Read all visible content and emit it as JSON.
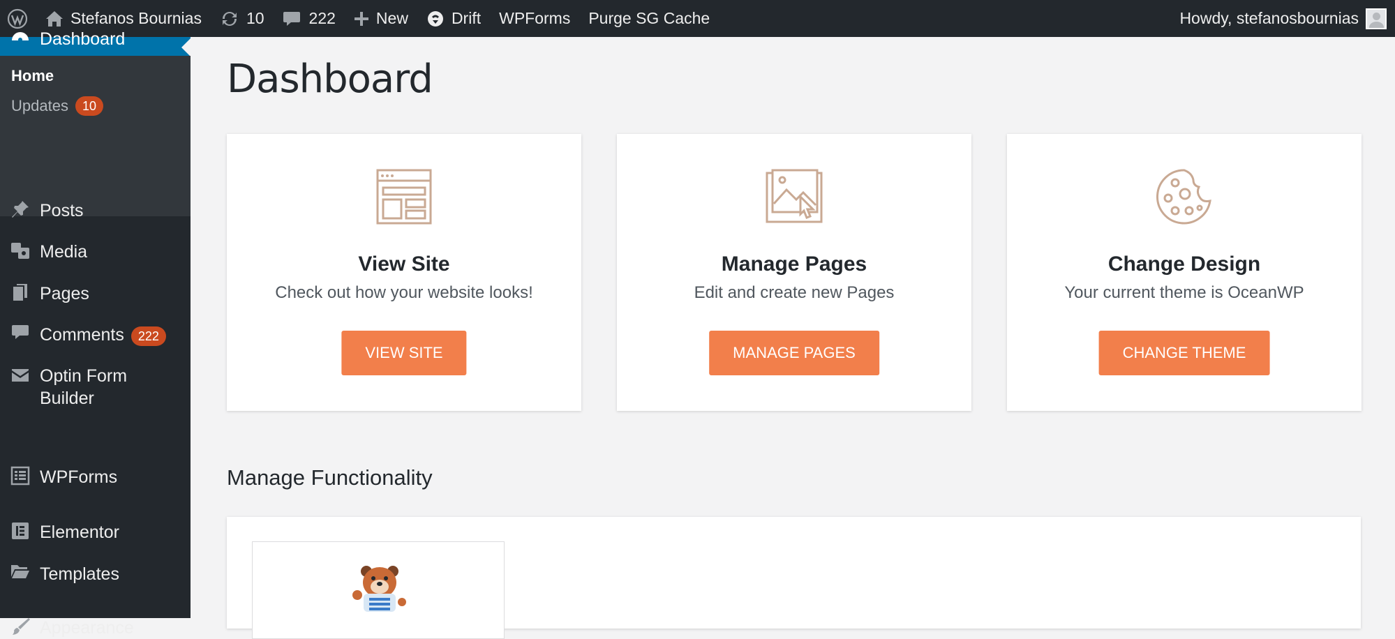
{
  "adminbar": {
    "site_name": "Stefanos Bournias",
    "updates_count": "10",
    "comments_count": "222",
    "new_label": "New",
    "drift_label": "Drift",
    "wpforms_label": "WPForms",
    "purge_label": "Purge SG Cache",
    "howdy": "Howdy, stefanosbournias"
  },
  "sidebar": {
    "current": "Dashboard",
    "submenu": {
      "home": "Home",
      "updates": "Updates",
      "updates_badge": "10"
    },
    "items": [
      {
        "label": "Posts",
        "icon": "pin-icon"
      },
      {
        "label": "Media",
        "icon": "media-icon"
      },
      {
        "label": "Pages",
        "icon": "pages-icon"
      },
      {
        "label": "Comments",
        "icon": "comment-icon",
        "badge": "222"
      },
      {
        "label": "Optin Form Builder",
        "icon": "email-icon"
      },
      {
        "label": "WPForms",
        "icon": "forms-icon"
      },
      {
        "label": "Elementor",
        "icon": "elementor-icon"
      },
      {
        "label": "Templates",
        "icon": "folder-icon"
      },
      {
        "label": "Appearance",
        "icon": "brush-icon"
      }
    ]
  },
  "main": {
    "title": "Dashboard",
    "cards": [
      {
        "title": "View Site",
        "desc": "Check out how your website looks!",
        "button": "VIEW SITE",
        "icon": "layout-icon"
      },
      {
        "title": "Manage Pages",
        "desc": "Edit and create new Pages",
        "button": "MANAGE PAGES",
        "icon": "image-cursor-icon"
      },
      {
        "title": "Change Design",
        "desc": "Your current theme is OceanWP",
        "button": "CHANGE THEME",
        "icon": "palette-icon"
      }
    ],
    "section_title": "Manage Functionality"
  },
  "colors": {
    "adminbar_bg": "#23282d",
    "active_menu": "#0073aa",
    "badge": "#ca4a1f",
    "button": "#f27f4b",
    "icon_tan": "#c9a993"
  }
}
